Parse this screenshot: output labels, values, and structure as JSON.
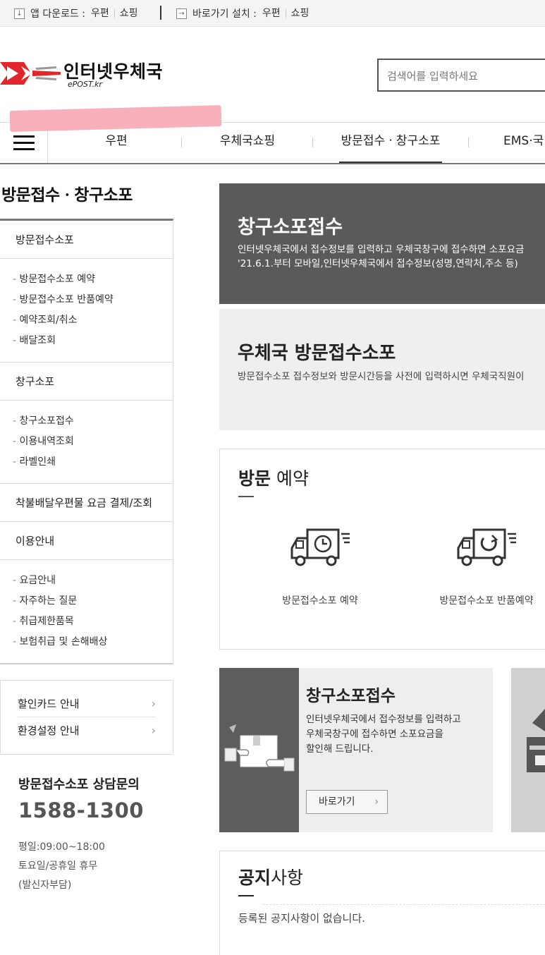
{
  "topbar": {
    "app_label": "앱 다운로드 :",
    "app_links": [
      "우편",
      "쇼핑"
    ],
    "shortcut_label": "바로가기 설치 :",
    "shortcut_links": [
      "우편",
      "쇼핑"
    ]
  },
  "header": {
    "logo_name": "인터넷우체국",
    "logo_sub": "ePOST.kr",
    "search_placeholder": "검색어를 입력하세요"
  },
  "gnb": {
    "items": [
      "우편",
      "우체국쇼핑",
      "방문접수ㆍ창구소포",
      "EMS·국"
    ],
    "active": "방문접수ㆍ창구소포"
  },
  "lnb": {
    "title": "방문접수ㆍ창구소포",
    "sections": [
      {
        "label": "방문접수소포",
        "subs": [
          "방문접수소포 예약",
          "방문접수소포 반품예약",
          "예약조회/취소",
          "배달조회"
        ]
      },
      {
        "label": "창구소포",
        "subs": [
          "창구소포접수",
          "이용내역조회",
          "라벨인쇄"
        ]
      },
      {
        "label": "착불배달우편물 요금 결제/조회",
        "subs": []
      },
      {
        "label": "이용안내",
        "subs": [
          "요금안내",
          "자주하는 질문",
          "취급제한품목",
          "보험취급 및 손해배상"
        ]
      }
    ]
  },
  "util": {
    "items": [
      "할인카드 안내",
      "환경설정 안내"
    ],
    "chevron": "›"
  },
  "cs": {
    "title": "방문접수소포 상담문의",
    "phone": "1588-1300",
    "hours": "평일:09:00~18:00",
    "holiday": "토요일/공휴일 휴무",
    "note": "(발신자부담)"
  },
  "banner1": {
    "title": "창구소포접수",
    "line1": "인터넷우체국에서 접수정보를 입력하고 우체국창구에 접수하면 소포요금",
    "line2": "'21.6.1.부터 모바일,인터넷우체국에서 접수정보(성명,연락처,주소 등)"
  },
  "banner2": {
    "title": "우체국 방문접수소포",
    "text": "방문접수소포 접수정보와 방문시간등을 사전에 입력하시면 우체국직원이"
  },
  "visit": {
    "title_bold": "방문",
    "title_rest": " 예약",
    "items": [
      "방문접수소포 예약",
      "방문접수소포 반품예약"
    ]
  },
  "card": {
    "title": "창구소포접수",
    "line1": "인터넷우체국에서 접수정보를 입력하고",
    "line2": "우체국창구에 접수하면 소포요금을",
    "line3": "할인해 드립니다.",
    "button": "바로가기",
    "chevron": "›"
  },
  "notice": {
    "title_bold": "공지",
    "title_rest": "사항",
    "text": "등록된 공지사항이 없습니다."
  },
  "colors": {
    "brand_red": "#e3262c",
    "dark_banner": "#5a5a5a",
    "light_banner": "#efefef"
  }
}
